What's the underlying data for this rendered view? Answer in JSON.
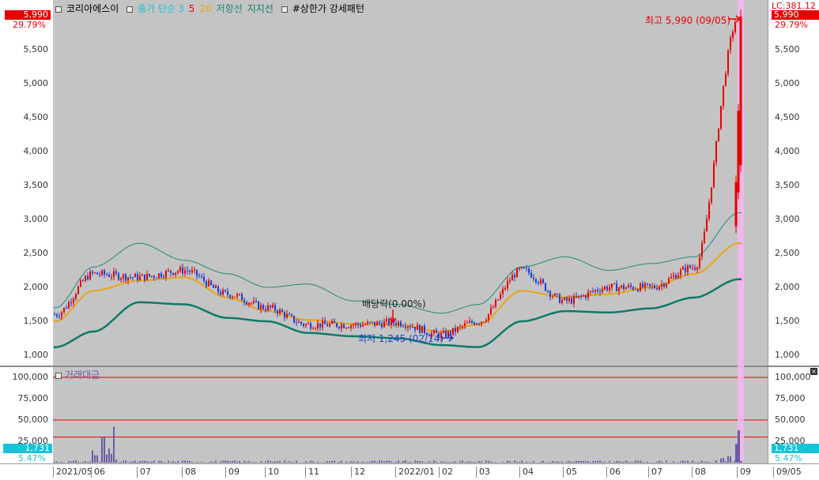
{
  "legend": {
    "stock_name": "코리아에스이",
    "ma_label": "종가 단순",
    "ma_periods": [
      "3",
      "5",
      "20"
    ],
    "resistance": "저항선",
    "support": "지지선",
    "pattern": "#상한가 강세패턴"
  },
  "volume_legend": "거래대금",
  "left_axis": {
    "current_price": "5,990",
    "change_pct": "29.79%",
    "price_ticks": [
      "5,500",
      "5,000",
      "4,500",
      "4,000",
      "3,500",
      "3,000",
      "2,500",
      "2,000",
      "1,500",
      "1,000"
    ],
    "volume_ticks": [
      "100,000",
      "75,000",
      "50,000",
      "25,000"
    ],
    "current_volume": "1,731",
    "volume_pct": "5.47%"
  },
  "right_axis": {
    "lc_label": "LC:381.12",
    "current_price": "5,990",
    "change_pct": "29.79%",
    "price_ticks": [
      "5,500",
      "5,000",
      "4,500",
      "4,000",
      "3,500",
      "3,000",
      "2,500",
      "2,000",
      "1,500",
      "1,000"
    ],
    "volume_ticks": [
      "100,000",
      "75,000",
      "50,000",
      "25,000"
    ],
    "current_volume": "1,731",
    "volume_pct": "5.47%"
  },
  "annotations": {
    "high": "최고 5,990 (09/05)",
    "low": "최저 1,245 (02/14)",
    "dividend": "배당락(0.00%)"
  },
  "x_axis": [
    "2021/05",
    "06",
    "07",
    "08",
    "09",
    "10",
    "11",
    "12",
    "2022/01",
    "02",
    "03",
    "04",
    "05",
    "06",
    "07",
    "08",
    "09",
    "09/05"
  ],
  "colors": {
    "up": "#e60000",
    "down": "#1a3fd1",
    "ma3": "#17c3d6",
    "ma5": "#e60000",
    "ma20": "#e8a317",
    "resistance": "#1f8a78",
    "support": "#0e7a6a",
    "badge_red": "#e60000",
    "badge_cyan": "#17c3d6",
    "volume": "#6b5aa6",
    "highlight": "#f4b6ee"
  },
  "chart_data": {
    "type": "candlestick",
    "price_range": [
      1000,
      6000
    ],
    "volume_range": [
      0,
      100000
    ],
    "volume_reference_lines": [
      100000,
      50000,
      30000
    ],
    "series": [
      {
        "name": "종가",
        "x": [
          "2021/05",
          "06",
          "07",
          "08",
          "09",
          "10",
          "11",
          "12",
          "2022/01",
          "02",
          "03",
          "04",
          "05",
          "06",
          "07",
          "08",
          "09"
        ],
        "values": [
          1600,
          2200,
          2150,
          2250,
          1900,
          1700,
          1450,
          1450,
          1480,
          1300,
          1500,
          2250,
          1800,
          2000,
          2000,
          2300,
          5990
        ]
      },
      {
        "name": "20",
        "x": [
          "2021/05",
          "06",
          "07",
          "08",
          "09",
          "10",
          "11",
          "12",
          "2022/01",
          "02",
          "03",
          "04",
          "05",
          "06",
          "07",
          "08",
          "09"
        ],
        "values": [
          1500,
          1950,
          2100,
          2150,
          1850,
          1650,
          1520,
          1460,
          1450,
          1350,
          1450,
          1950,
          1850,
          1900,
          2000,
          2200,
          2650
        ]
      },
      {
        "name": "저항선",
        "x": [
          "2021/05",
          "06",
          "07",
          "08",
          "09",
          "10",
          "11",
          "12",
          "2022/01",
          "02",
          "03",
          "04",
          "05",
          "06",
          "07",
          "08",
          "09"
        ],
        "values": [
          1700,
          2300,
          2650,
          2400,
          2200,
          2000,
          2050,
          1800,
          1750,
          1620,
          1750,
          2300,
          2450,
          2250,
          2350,
          2450,
          3100
        ]
      },
      {
        "name": "지지선",
        "x": [
          "2021/05",
          "06",
          "07",
          "08",
          "09",
          "10",
          "11",
          "12",
          "2022/01",
          "02",
          "03",
          "04",
          "05",
          "06",
          "07",
          "08",
          "09"
        ],
        "values": [
          1120,
          1350,
          1780,
          1750,
          1550,
          1500,
          1330,
          1280,
          1250,
          1150,
          1120,
          1500,
          1650,
          1630,
          1690,
          1850,
          2120
        ]
      }
    ],
    "volume": {
      "max_spike": 42000,
      "latest": 1731
    }
  }
}
